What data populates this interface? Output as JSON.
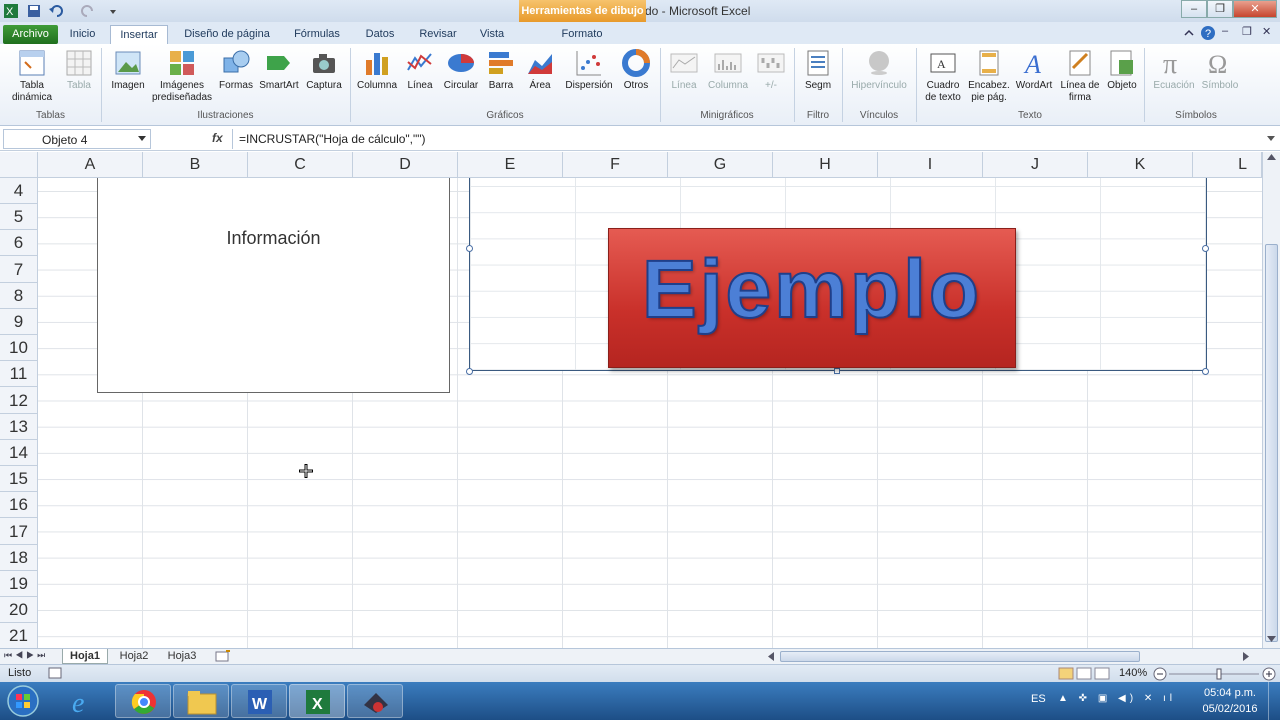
{
  "window": {
    "title": "Insertr objeto incrustado  -  Microsoft Excel",
    "context_tab": "Herramientas de dibujo"
  },
  "tabs": [
    "Archivo",
    "Inicio",
    "Insertar",
    "Diseño de página",
    "Fórmulas",
    "Datos",
    "Revisar",
    "Vista",
    "Formato"
  ],
  "ribbon": {
    "tabla_dinamica": "Tabla\ndinámica",
    "tabla": "Tabla",
    "imagen": "Imagen",
    "imagenes": "Imágenes\nprediseñadas",
    "formas": "Formas",
    "smartart": "SmartArt",
    "captura": "Captura",
    "columna": "Columna",
    "linea": "Línea",
    "circular": "Circular",
    "barra": "Barra",
    "area": "Área",
    "dispersion": "Dispersión",
    "otros": "Otros",
    "mini_linea": "Línea",
    "mini_columna": "Columna",
    "mini_pm": "+/-",
    "segm": "Segm",
    "hipervinculo": "Hipervínculo",
    "cuadro": "Cuadro\nde texto",
    "encabez": "Encabez.\npie pág.",
    "wordart": "WordArt",
    "linea_firma": "Línea de\nfirma",
    "objeto": "Objeto",
    "ecuacion": "Ecuación",
    "simbolo": "Símbolo",
    "groups": {
      "tablas": "Tablas",
      "ilustraciones": "Ilustraciones",
      "graficos": "Gráficos",
      "minigraficos": "Minigráficos",
      "filtro": "Filtro",
      "vinculos": "Vínculos",
      "texto": "Texto",
      "simbolos": "Símbolos"
    }
  },
  "formula_bar": {
    "name_box": "Objeto 4",
    "fx": "fx",
    "formula": "=INCRUSTAR(\"Hoja de cálculo\",\"\")"
  },
  "columns": [
    "A",
    "B",
    "C",
    "D",
    "E",
    "F",
    "G",
    "H",
    "I",
    "J",
    "K",
    "L"
  ],
  "rows": [
    "4",
    "5",
    "6",
    "7",
    "8",
    "9",
    "10",
    "11",
    "12",
    "13",
    "14",
    "15",
    "16",
    "17",
    "18",
    "19",
    "20",
    "21"
  ],
  "cells": {
    "info_text": "Información",
    "embedded_text": "Ejemplo"
  },
  "sheets": [
    "Hoja1",
    "Hoja2",
    "Hoja3"
  ],
  "status": {
    "ready": "Listo",
    "zoom": "140%"
  },
  "tray": {
    "lang": "ES",
    "time": "05:04 p.m.",
    "date": "05/02/2016"
  },
  "colors": {
    "accent": "#1f6f1e",
    "embedded_box": "#c9302a",
    "embedded_text": "#4c7fd6"
  }
}
